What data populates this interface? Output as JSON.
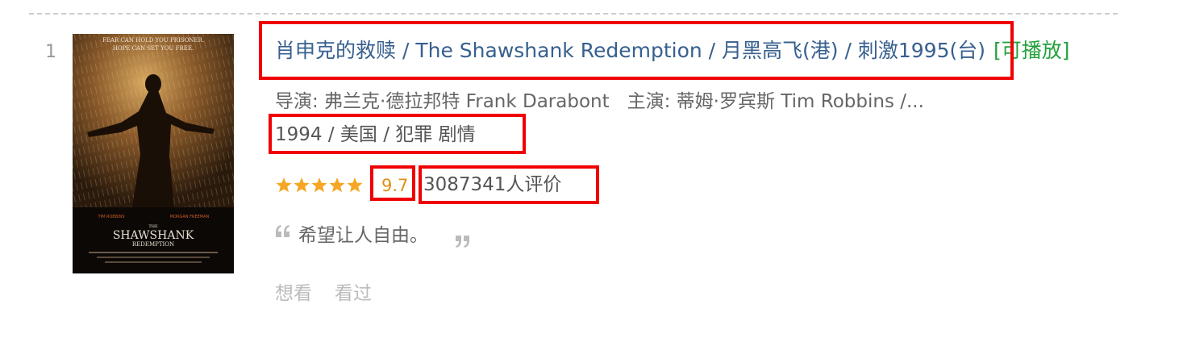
{
  "item": {
    "rank": "1",
    "poster": {
      "tagline_line1": "FEAR CAN HOLD YOU PRISONER.",
      "tagline_line2": "HOPE CAN SET YOU FREE.",
      "cast_left": "TIM ROBBINS",
      "cast_right": "MORGAN FREEMAN",
      "title_the": "THE",
      "title_main": "SHAWSHANK",
      "title_sub": "REDEMPTION"
    },
    "title": {
      "main": "肖申克的救赎",
      "sep1": " / ",
      "english": "The Shawshank Redemption",
      "sep2": " / ",
      "other": "月黑高飞(港) / 刺激1995(台)",
      "playable": "[可播放]"
    },
    "credits": {
      "director": "导演: 弗兰克·德拉邦特 Frank Darabont",
      "cast": "主演: 蒂姆·罗宾斯 Tim Robbins /..."
    },
    "meta": "1994 / 美国 / 犯罪 剧情",
    "rating": {
      "stars": 5,
      "score": "9.7",
      "votes": "3087341人评价"
    },
    "quote": "希望让人自由。",
    "actions": {
      "want": "想看",
      "seen": "看过"
    }
  },
  "colors": {
    "link": "#37608e",
    "playable": "#23a23c",
    "score": "#e09015",
    "star": "#f5a623",
    "highlight": "#f00000"
  }
}
